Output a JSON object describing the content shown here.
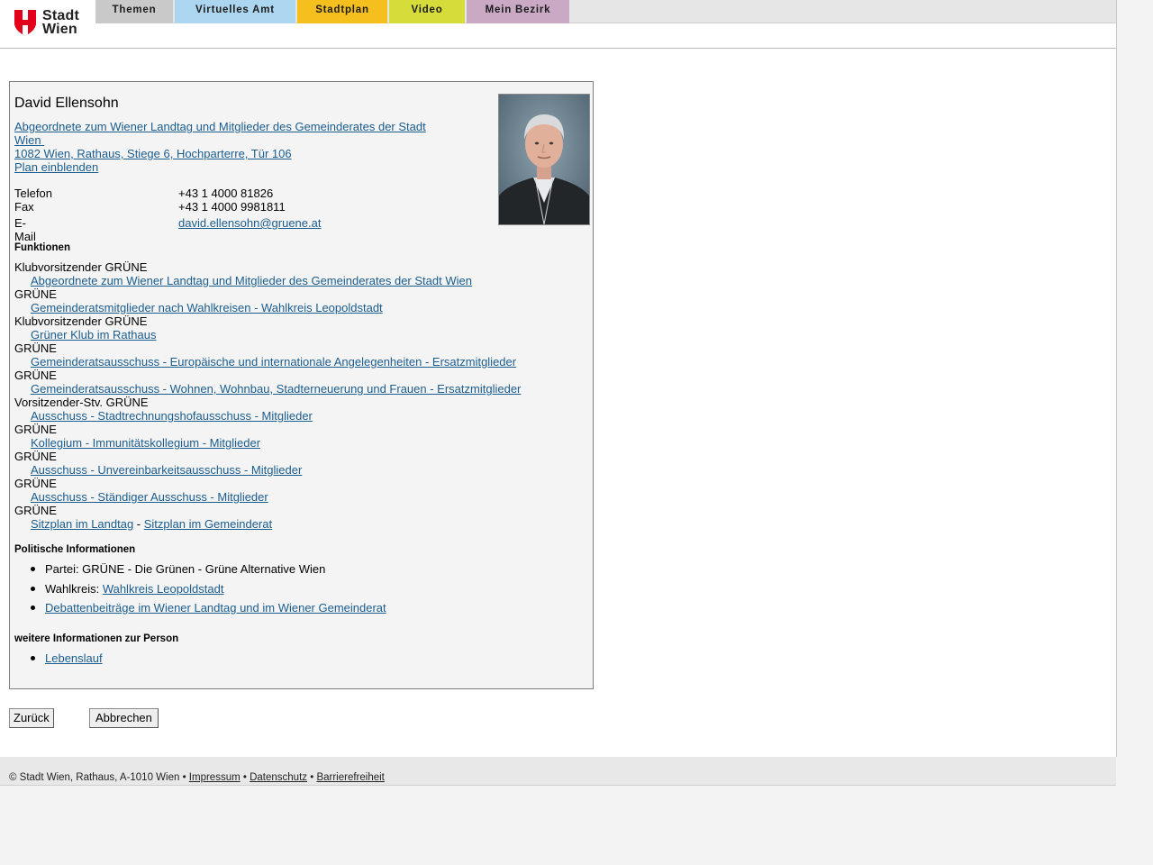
{
  "header": {
    "logo_text_line1": "Stadt",
    "logo_text_line2": "Wien",
    "tabs": [
      {
        "label": "Themen",
        "color": "#c9c9c9"
      },
      {
        "label": "Virtuelles Amt",
        "color": "#acd6ef"
      },
      {
        "label": "Stadtplan",
        "color": "#f5c01d"
      },
      {
        "label": "Video",
        "color": "#d6dd3a"
      },
      {
        "label": "Mein Bezirk",
        "color": "#c9a9c4"
      }
    ]
  },
  "person": {
    "name": "David Ellensohn",
    "role_link_line1": "Abgeordnete zum Wiener Landtag und Mitglieder des Gemeinderates der Stadt",
    "role_link_line2": "Wien",
    "address": "1082 Wien, Rathaus, Stiege 6, Hochparterre, Tür 106",
    "map_link": "Plan einblenden",
    "contact": [
      {
        "label": "Telefon",
        "value": "+43 1 4000 81826"
      },
      {
        "label": "Fax",
        "value": "+43 1 4000 9981811"
      },
      {
        "label": "E-Mail",
        "value": "david.ellensohn@gruene.at"
      }
    ]
  },
  "functions": {
    "title": "Funktionen",
    "items": [
      {
        "role": "Klubvorsitzender GRÜNE",
        "link": "Abgeordnete zum Wiener Landtag und Mitglieder des Gemeinderates der Stadt Wien"
      },
      {
        "role": "GRÜNE",
        "link": "Gemeinderatsmitglieder nach Wahlkreisen - Wahlkreis Leopoldstadt"
      },
      {
        "role": "Klubvorsitzender GRÜNE",
        "link": "Grüner Klub im Rathaus"
      },
      {
        "role": "GRÜNE",
        "link": "Gemeinderatsausschuss - Europäische und internationale Angelegenheiten - Ersatzmitglieder"
      },
      {
        "role": "GRÜNE",
        "link": "Gemeinderatsausschuss - Wohnen, Wohnbau, Stadterneuerung und Frauen - Ersatzmitglieder"
      },
      {
        "role": "Vorsitzender-Stv. GRÜNE",
        "link": "Ausschuss - Stadtrechnungshofausschuss - Mitglieder"
      },
      {
        "role": "GRÜNE",
        "link": "Kollegium - Immunitätskollegium - Mitglieder"
      },
      {
        "role": "GRÜNE",
        "link": "Ausschuss - Unvereinbarkeitsausschuss - Mitglieder"
      },
      {
        "role": "GRÜNE",
        "link": "Ausschuss - Ständiger Ausschuss - Mitglieder"
      }
    ],
    "last_role": "GRÜNE",
    "seat_link_1": "Sitzplan im Landtag",
    "seat_separator": " - ",
    "seat_link_2": "Sitzplan im Gemeinderat"
  },
  "political": {
    "title": "Politische Informationen",
    "party": "Partei: GRÜNE - Die Grünen - Grüne Alternative Wien",
    "district_label": "Wahlkreis: ",
    "district_link": "Wahlkreis Leopoldstadt",
    "debates_link": "Debattenbeiträge im Wiener Landtag und im Wiener Gemeinderat"
  },
  "more": {
    "title": "weitere Informationen zur Person",
    "cv_link": "Lebenslauf"
  },
  "buttons": {
    "back": "Zurück",
    "cancel": "Abbrechen"
  },
  "footer": {
    "copyright": "© Stadt Wien, Rathaus, A-1010 Wien • ",
    "impressum": "Impressum",
    "sep1": " • ",
    "datenschutz": "Datenschutz",
    "sep2": " • ",
    "barrierefreiheit": "Barrierefreiheit"
  }
}
